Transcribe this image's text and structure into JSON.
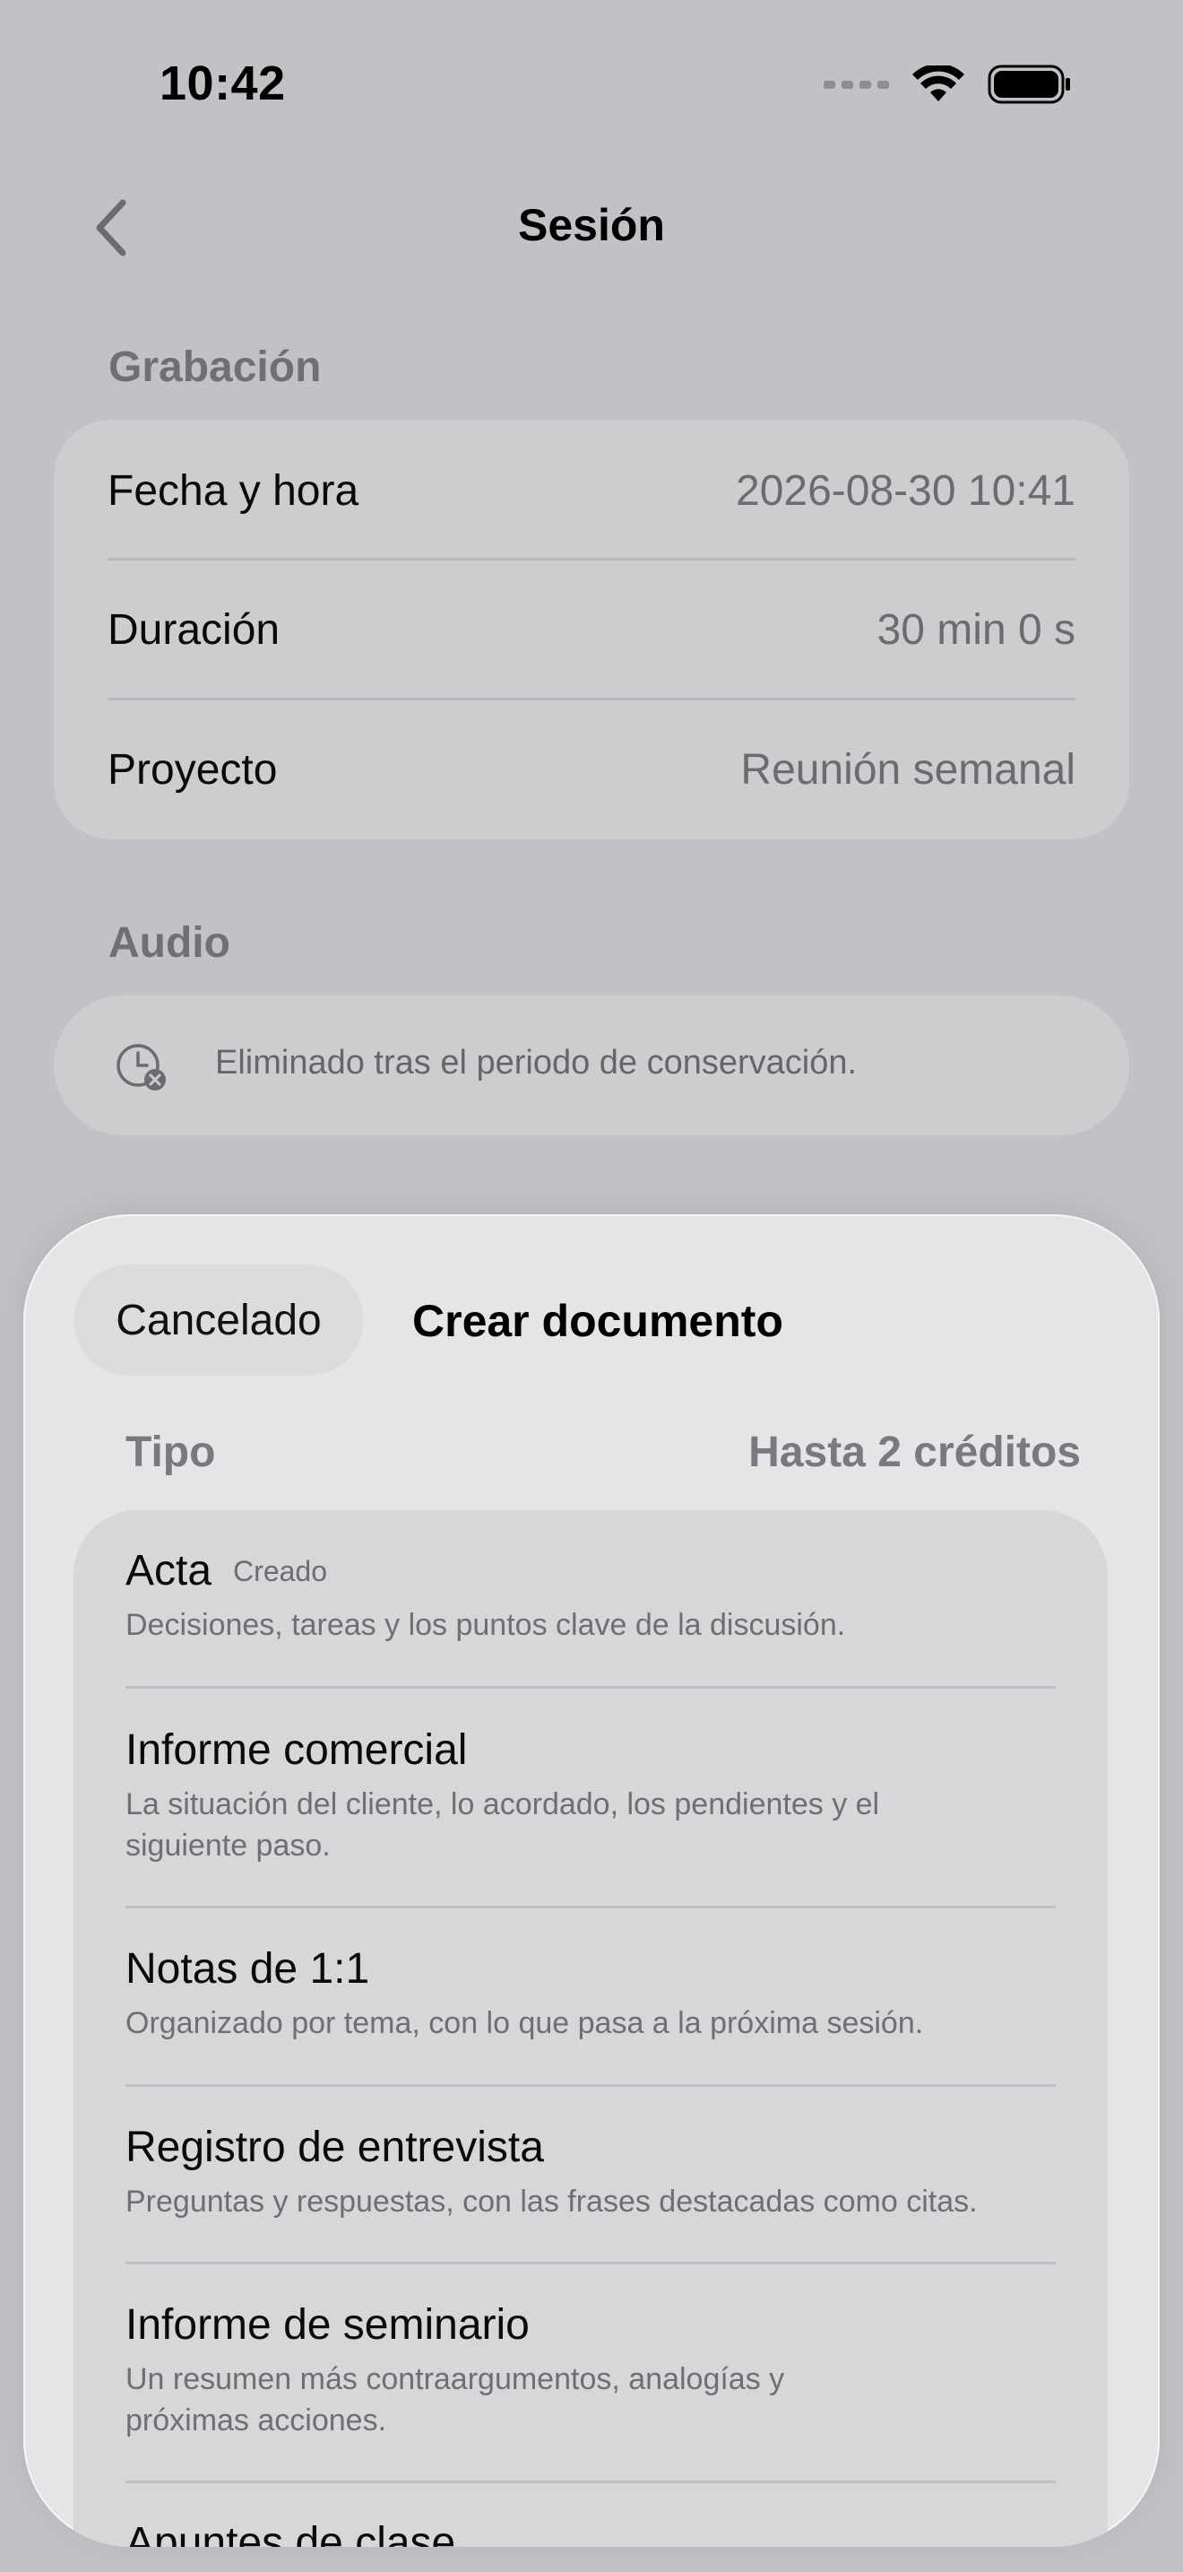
{
  "status_bar": {
    "time": "10:42"
  },
  "nav": {
    "title": "Sesión",
    "back_icon": "chevron-left-icon"
  },
  "grabacion": {
    "header": "Grabación",
    "rows": [
      {
        "label": "Fecha y hora",
        "value": "2026-08-30 10:41"
      },
      {
        "label": "Duración",
        "value": "30 min 0 s"
      },
      {
        "label": "Proyecto",
        "value": "Reunión semanal"
      }
    ]
  },
  "audio": {
    "header": "Audio",
    "status_text": "Eliminado tras el periodo de conservación.",
    "icon": "clock-delete-icon"
  },
  "sheet": {
    "cancel_label": "Cancelado",
    "title": "Crear documento",
    "type_label": "Tipo",
    "credits_label": "Hasta 2 créditos",
    "items": [
      {
        "title": "Acta",
        "badge": "Creado",
        "description": "Decisiones, tareas y los puntos clave de la discusión."
      },
      {
        "title": "Informe comercial",
        "badge": "",
        "description": "La situación del cliente, lo acordado, los pendientes y el siguiente paso."
      },
      {
        "title": "Notas de 1:1",
        "badge": "",
        "description": "Organizado por tema, con lo que pasa a la próxima sesión."
      },
      {
        "title": "Registro de entrevista",
        "badge": "",
        "description": "Preguntas y respuestas, con las frases destacadas como citas."
      },
      {
        "title": "Informe de seminario",
        "badge": "",
        "description": "Un resumen más contraargumentos, analogías y próximas acciones."
      },
      {
        "title": "Apuntes de clase",
        "badge": "",
        "description": ""
      }
    ]
  }
}
